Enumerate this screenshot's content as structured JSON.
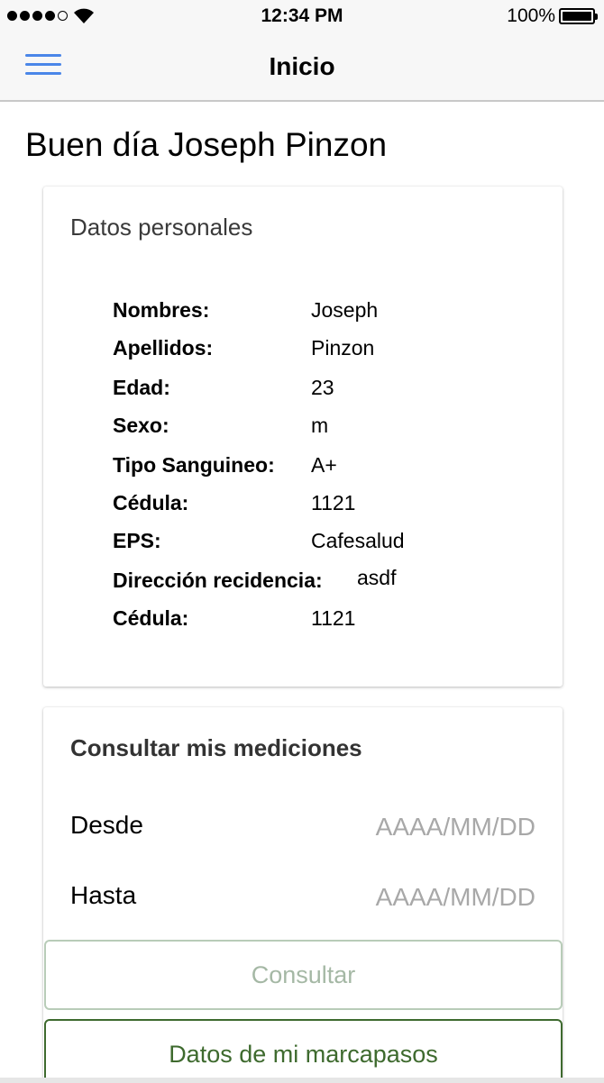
{
  "status_bar": {
    "time": "12:34 PM",
    "battery": "100%"
  },
  "nav": {
    "title": "Inicio",
    "menu_icon": "hamburger-menu-icon",
    "menu_color": "#4a86e8"
  },
  "greeting": "Buen día Joseph Pinzon",
  "personal": {
    "title": "Datos personales",
    "rows": [
      {
        "label": "Nombres:",
        "value": "Joseph"
      },
      {
        "label": "Apellidos:",
        "value": "Pinzon"
      },
      {
        "label": "Edad:",
        "value": "23"
      },
      {
        "label": "Sexo:",
        "value": "m"
      },
      {
        "label": "Tipo Sanguineo:",
        "value": "A+"
      },
      {
        "label": "Cédula:",
        "value": "1121"
      },
      {
        "label": "EPS:",
        "value": "Cafesalud"
      },
      {
        "label": "Dirección recidencia:",
        "value": "asdf"
      },
      {
        "label": "Cédula:",
        "value": "1121"
      }
    ]
  },
  "query": {
    "title": "Consultar mis mediciones",
    "from_label": "Desde",
    "from_placeholder": "AAAA/MM/DD",
    "to_label": "Hasta",
    "to_placeholder": "AAAA/MM/DD",
    "consult_button": "Consultar",
    "pacemaker_button": "Datos de mi marcapasos"
  },
  "colors": {
    "accent_green": "#3e6a2e",
    "disabled_green": "#a5b8a5"
  }
}
